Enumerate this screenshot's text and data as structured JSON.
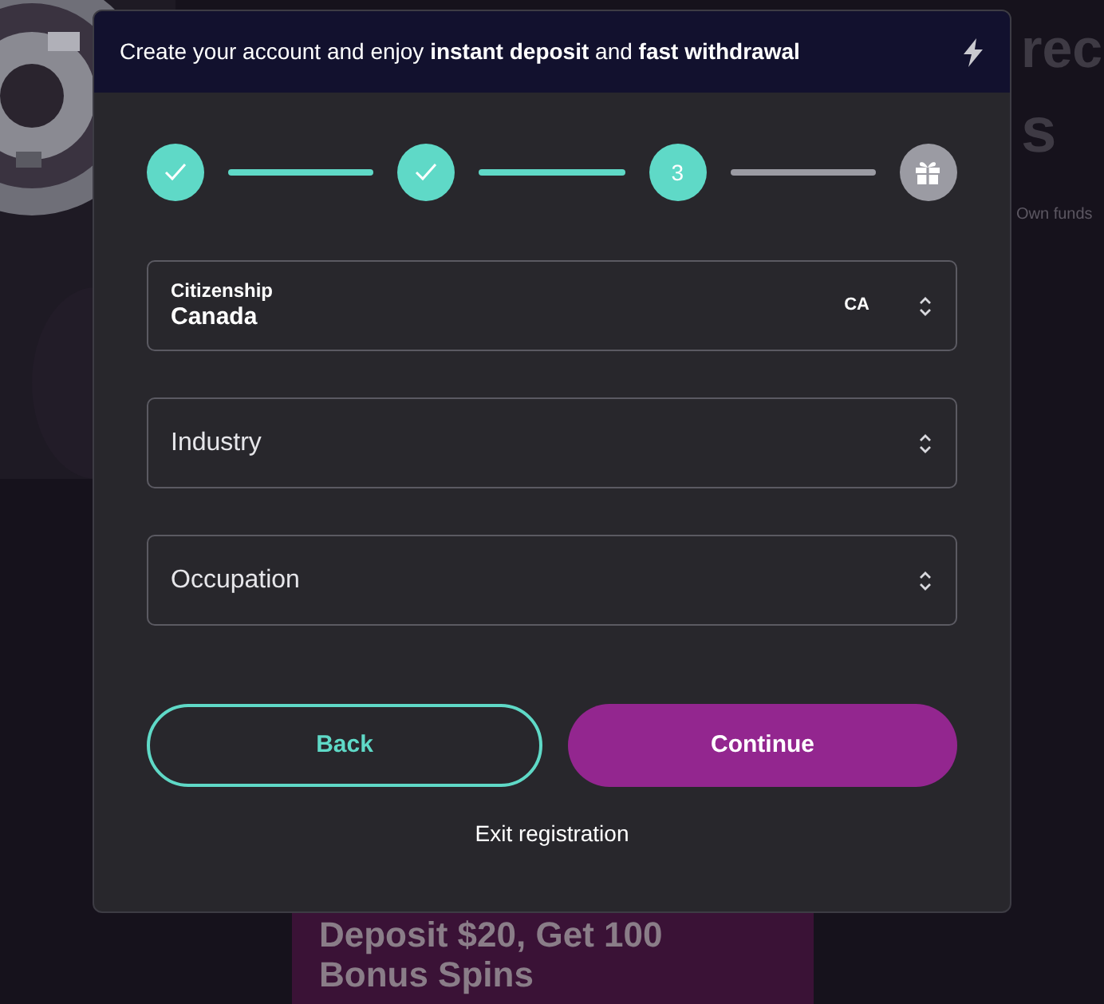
{
  "background": {
    "headline_1": "rec",
    "headline_2": "s",
    "note": "Own funds",
    "promo_title": "Deposit $20, Get 100",
    "promo_subtitle": "Bonus Spins"
  },
  "modal": {
    "banner": "Create your account and enjoy **instant deposit** and **fast withdrawal**",
    "steps": [
      {
        "kind": "done"
      },
      {
        "kind": "done"
      },
      {
        "kind": "current",
        "label": "3"
      },
      {
        "kind": "gift"
      }
    ],
    "connectors": [
      {
        "completed": true
      },
      {
        "completed": true
      },
      {
        "completed": false
      }
    ],
    "fields": [
      {
        "label": "Citizenship",
        "value": "Canada",
        "code": "CA"
      },
      {
        "placeholder": "Industry"
      },
      {
        "placeholder": "Occupation"
      }
    ],
    "back_button": "Back",
    "continue_button": "Continue",
    "exit_link": "Exit registration"
  }
}
